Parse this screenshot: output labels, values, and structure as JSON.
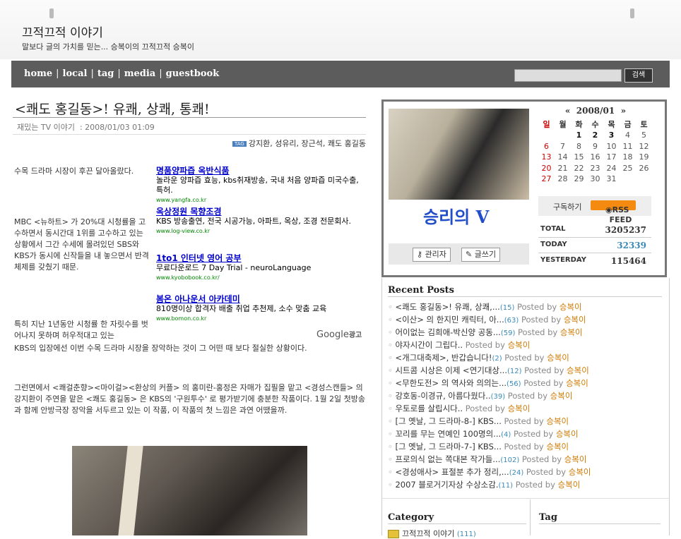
{
  "site": {
    "title": "끄적끄적 이야기",
    "description": "말보다 글의 가치를 믿는... 승복이의 끄적끄적 승복이"
  },
  "nav": {
    "items": [
      "home",
      "local",
      "tag",
      "media",
      "guestbook"
    ],
    "search_button": "검색",
    "search_value": ""
  },
  "post": {
    "title": "<쾌도 홍길동>! 유쾌, 상쾌, 통쾌!",
    "category": "재밌는 TV 이야기",
    "date": "2008/01/03 01:09",
    "tags": "강지환, 성유리, 장근석, 쾌도 홍길동",
    "paragraphs": [
      "수목 드라마 시장이 후끈 달아올랐다.",
      "MBC <뉴하트> 가 20%대 시청률을 고수하면서 동시간대 1위를 고수하고 있는 상황에서 그간 수세에 몰려있던 SBS와 KBS가 동시에 신작들을 내 놓으면서 반격체제를 갖췄기 때문.",
      "특히 지난 1년동안 시청률 한 자릿수를 벗어나지 못하며 허우적대고 있는",
      "KBS의 입장에선 이번 수목 드라마 시장을 장악하는 것이 그 어떤 때 보다 절실한 상황이다.",
      "그런면에서 <쾌걸춘향><마이걸><환상의 커플> 의 홍미란-홍정은 자매가 집필을 맡고 <경성스캔들> 의 강지환이 주연을 맡은 <쾌도 홍길동> 은 KBS의 '구원투수' 로 평가받기에 충분한 작품이다. 1월 2일 첫방송과 함께 안방극장 장악을 서두르고 있는 이 작품, 이 작품의 첫 느낌은 과연 어땠을까."
    ]
  },
  "ads": [
    {
      "title": "명품양파즙 옥반식품",
      "desc": "놀라운 양파즙 효능, kbs취재방송, 국내 처음 양파즙 미국수출, 특허.",
      "url": "www.yangfa.co.kr"
    },
    {
      "title": "옥상정원 목향조경",
      "desc": "KBS 방송출연, 전국 시공가능, 아파트, 옥상, 조경 전문회사.",
      "url": "www.log-view.co.kr"
    },
    {
      "title": "1to1 인터넷 영어 공부",
      "desc": "무료다운로드 7 Day Trial - neuroLanguage",
      "url": "www.kyobobook.co.kr/"
    },
    {
      "title": "봄온 아나운서 아카데미",
      "desc": "810명이상 합격자 배출 취업 추천제, 소수 맞춤 교육",
      "url": "www.bomon.co.kr"
    }
  ],
  "google_ads_label": {
    "brand": "Google",
    "suffix": "광고"
  },
  "sidebar": {
    "profile_caption": "승리의 V",
    "admin_button": "관리자",
    "write_button": "글쓰기",
    "calendar": {
      "month": "2008/01",
      "prev": "«",
      "next": "»",
      "weekdays": [
        "일",
        "월",
        "화",
        "수",
        "목",
        "금",
        "토"
      ],
      "weeks": [
        [
          "",
          "",
          "1",
          "2",
          "3",
          "4",
          "5"
        ],
        [
          "6",
          "7",
          "8",
          "9",
          "10",
          "11",
          "12"
        ],
        [
          "13",
          "14",
          "15",
          "16",
          "17",
          "18",
          "19"
        ],
        [
          "20",
          "21",
          "22",
          "23",
          "24",
          "25",
          "26"
        ],
        [
          "27",
          "28",
          "29",
          "30",
          "31",
          "",
          ""
        ]
      ],
      "post_days": [
        "1",
        "2",
        "3"
      ]
    },
    "subscribe_label": "구독하기",
    "rss_label": "RSS FEED",
    "stats": [
      {
        "label": "TOTAL",
        "value": "3205237"
      },
      {
        "label": "TODAY",
        "value": "32339"
      },
      {
        "label": "YESTERDAY",
        "value": "115464"
      }
    ],
    "recent_heading": "Recent Posts",
    "recent": [
      {
        "title": "<쾌도 홍길동>! 유쾌, 상쾌,...",
        "count": "(15)",
        "author": "승복이"
      },
      {
        "title": "<이산> 의 한지민 캐릭터, 아...",
        "count": "(63)",
        "author": "승복이"
      },
      {
        "title": "어이없는 김희애-박신양 공동...",
        "count": "(59)",
        "author": "승복이"
      },
      {
        "title": "야자시간이 그립다..",
        "count": "",
        "author": "승복이"
      },
      {
        "title": "<개그대축제>, 반갑습니다!",
        "count": "(2)",
        "author": "승복이"
      },
      {
        "title": "시트콤 시상은 이제 <연기대상...",
        "count": "(12)",
        "author": "승복이"
      },
      {
        "title": "<무한도전> 의 역사와 의의는...",
        "count": "(56)",
        "author": "승복이"
      },
      {
        "title": "강호동-이경규, 아름다웠다..",
        "count": "(39)",
        "author": "승복이"
      },
      {
        "title": "우토로를 살립시다..",
        "count": "",
        "author": "승복이"
      },
      {
        "title": "[그 옛날, 그 드라마-8-] KBS...",
        "count": "",
        "author": "승복이"
      },
      {
        "title": "꼬리를 무는 연예인 100명의...",
        "count": "(4)",
        "author": "승복이"
      },
      {
        "title": "[그 옛날, 그 드라마-7-] KBS...",
        "count": "",
        "author": "승복이"
      },
      {
        "title": "프로의식 없는 쪽대본 작가들...",
        "count": "(102)",
        "author": "승복이"
      },
      {
        "title": "<경성애사> 표절분 추가 정리,...",
        "count": "(24)",
        "author": "승복이"
      },
      {
        "title": "2007 블로거기자상 수상소감.",
        "count": "(11)",
        "author": "승복이"
      }
    ],
    "posted_by": "Posted by",
    "category_heading": "Category",
    "category_item": {
      "name": "끄적끄적 이야기",
      "count": "(111)"
    },
    "tag_heading": "Tag"
  },
  "colors": {
    "nav_bg": "#5c5c5c",
    "link": "#0000cc",
    "ad_url": "#008800",
    "count": "#3a8ab8",
    "author": "#d07a00",
    "sunday": "#cc0000",
    "rss": "#f48a10"
  },
  "icons": [
    "tag-icon",
    "rss-icon",
    "folder-icon",
    "key-icon",
    "pencil-icon"
  ]
}
